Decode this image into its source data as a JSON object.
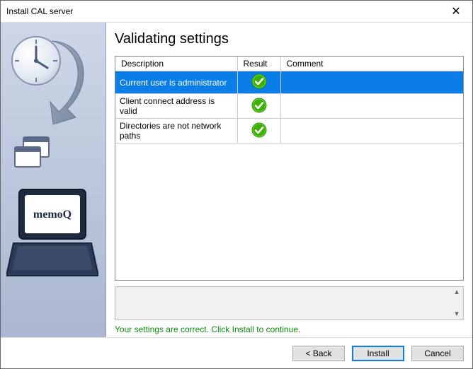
{
  "window": {
    "title": "Install CAL server"
  },
  "heading": "Validating settings",
  "columns": {
    "description": "Description",
    "result": "Result",
    "comment": "Comment"
  },
  "rows": [
    {
      "description": "Current user is administrator",
      "result": "ok",
      "comment": "",
      "selected": true
    },
    {
      "description": "Client connect address is valid",
      "result": "ok",
      "comment": "",
      "selected": false
    },
    {
      "description": "Directories are not network paths",
      "result": "ok",
      "comment": "",
      "selected": false
    }
  ],
  "status": "Your settings are correct. Click Install to continue.",
  "buttons": {
    "back": "< Back",
    "install": "Install",
    "cancel": "Cancel"
  },
  "sidebar": {
    "logo_text": "memoQ"
  }
}
